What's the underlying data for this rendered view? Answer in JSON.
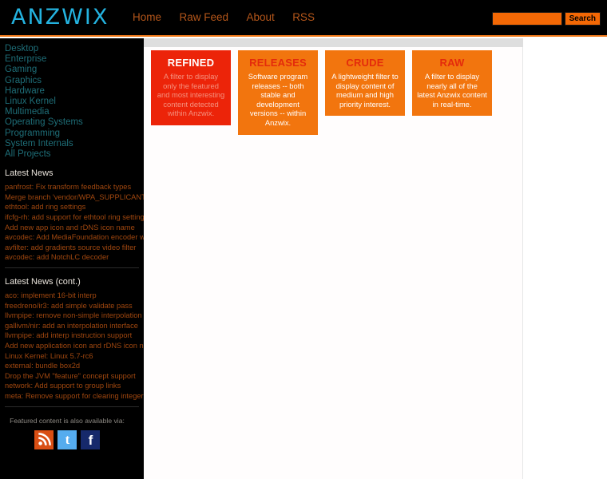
{
  "site": {
    "logo_text": "ANZWIX",
    "logo_color": "#24b3e0"
  },
  "header": {
    "nav": [
      {
        "label": "Home"
      },
      {
        "label": "Raw Feed"
      },
      {
        "label": "About"
      },
      {
        "label": "RSS"
      }
    ],
    "search": {
      "value": "",
      "placeholder": "",
      "button_label": "Search",
      "field_color": "#f36805"
    }
  },
  "sidebar": {
    "categories": [
      {
        "label": "Desktop"
      },
      {
        "label": "Enterprise"
      },
      {
        "label": "Gaming"
      },
      {
        "label": "Graphics"
      },
      {
        "label": "Hardware"
      },
      {
        "label": "Linux Kernel"
      },
      {
        "label": "Multimedia"
      },
      {
        "label": "Operating Systems"
      },
      {
        "label": "Programming"
      },
      {
        "label": "System Internals"
      },
      {
        "label": "All Projects"
      }
    ],
    "category_color": "#1e6e78",
    "news_color": "#a0470f",
    "news_section_1": {
      "title": "Latest News",
      "items": [
        {
          "label": "panfrost: Fix transform feedback types"
        },
        {
          "label": "Merge branch 'vendor/WPA_SUPPLICANT'"
        },
        {
          "label": "ethtool: add ring settings"
        },
        {
          "label": "ifcfg-rh: add support for ethtool ring settings"
        },
        {
          "label": "Add new app icon and rDNS icon name"
        },
        {
          "label": "avcodec: Add MediaFoundation encoder wrapper"
        },
        {
          "label": "avfilter: add gradients source video filter"
        },
        {
          "label": "avcodec: add NotchLC decoder"
        }
      ]
    },
    "news_section_2": {
      "title": "Latest News (cont.)",
      "items": [
        {
          "label": "aco: implement 16-bit interp"
        },
        {
          "label": "freedreno/ir3: add simple validate pass"
        },
        {
          "label": "llvmpipe: remove non-simple interpolation paths"
        },
        {
          "label": "gallivm/nir: add an interpolation interface"
        },
        {
          "label": "llvmpipe: add interp instruction support"
        },
        {
          "label": "Add new application icon and rDNS icon name"
        },
        {
          "label": "Linux Kernel: Linux 5.7-rc6"
        },
        {
          "label": "external: bundle box2d"
        },
        {
          "label": "Drop the JVM \"feature\" concept support"
        },
        {
          "label": "network: Add support to group links"
        },
        {
          "label": "meta: Remove support for clearing integer buffers"
        }
      ]
    },
    "featured_note": "Featured content is also available via:",
    "social": [
      {
        "name": "rss",
        "label": "RSS",
        "color": "#d94f14"
      },
      {
        "name": "twitter",
        "label": "Twitter",
        "color": "#55acee"
      },
      {
        "name": "facebook",
        "label": "Facebook",
        "color": "#16296b"
      }
    ]
  },
  "main": {
    "tiles": [
      {
        "title": "REFINED",
        "description": "A filter to display only the featured and most interesting content detected within Anzwix.",
        "bg": "#ec2409"
      },
      {
        "title": "RELEASES",
        "description": "Software program releases -- both stable and development versions -- within Anzwix.",
        "bg": "#f2750e"
      },
      {
        "title": "CRUDE",
        "description": "A lightweight filter to display content of medium and high priority interest.",
        "bg": "#f2750e"
      },
      {
        "title": "RAW",
        "description": "A filter to display nearly all of the latest Anzwix content in real-time.",
        "bg": "#f2750e"
      }
    ]
  }
}
